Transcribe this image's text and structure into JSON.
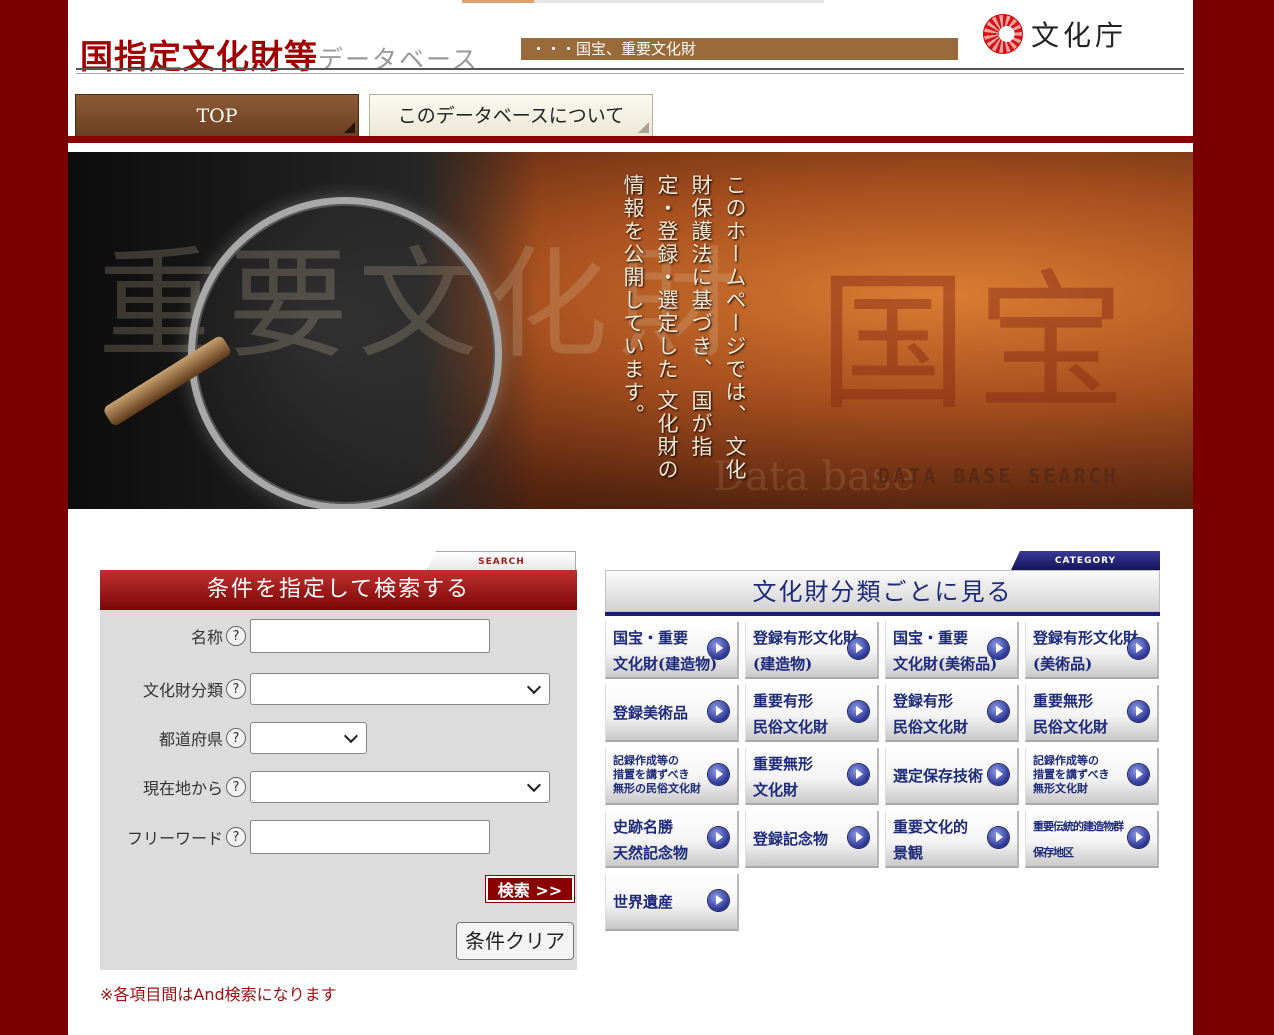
{
  "header": {
    "title_main": "国指定文化財等",
    "title_sub": "データベース",
    "band_text": "・・・国宝、重要文化財",
    "logo_text": "文化庁"
  },
  "tabs": [
    {
      "label": "TOP"
    },
    {
      "label": "このデータベースについて"
    }
  ],
  "hero": {
    "vertical_text": "このホームページでは、\n文化財保護法に基づき、\n国が指定・登録・選定した\n文化財の情報を公開しています。",
    "caption": "DATA BASE SEARCH",
    "caption_bg": "Data base",
    "bg_left": "重要文化財",
    "bg_right": "国宝"
  },
  "search": {
    "tag": "SEARCH",
    "heading": "条件を指定して検索する",
    "help_glyph": "?",
    "fields": [
      {
        "label": "名称",
        "value": ""
      },
      {
        "label": "文化財分類",
        "value": ""
      },
      {
        "label": "都道府県",
        "value": ""
      },
      {
        "label": "現在地から",
        "value": ""
      },
      {
        "label": "フリーワード",
        "value": ""
      }
    ],
    "search_button": "検索 >>",
    "clear_button": "条件クリア",
    "note": "※各項目間はAnd検索になります"
  },
  "category": {
    "tag": "CATEGORY",
    "heading": "文化財分類ごとに見る",
    "items": [
      {
        "label": "国宝・重要\n文化財(建造物)"
      },
      {
        "label": "登録有形文化財\n(建造物)"
      },
      {
        "label": "国宝・重要\n文化財(美術品)"
      },
      {
        "label": "登録有形文化財\n(美術品)"
      },
      {
        "label": "登録美術品"
      },
      {
        "label": "重要有形\n民俗文化財"
      },
      {
        "label": "登録有形\n民俗文化財"
      },
      {
        "label": "重要無形\n民俗文化財"
      },
      {
        "label": "記録作成等の\n措置を講ずべき\n無形の民俗文化財"
      },
      {
        "label": "重要無形\n文化財"
      },
      {
        "label": "選定保存技術"
      },
      {
        "label": "記録作成等の\n措置を講ずべき\n無形文化財"
      },
      {
        "label": "史跡名勝\n天然記念物"
      },
      {
        "label": "登録記念物"
      },
      {
        "label": "重要文化的\n景観"
      },
      {
        "label": "重要伝統的建造物群\n保存地区"
      },
      {
        "label": "世界遺産"
      }
    ]
  },
  "colors": {
    "frame": "#7a0000",
    "accent_red": "#8a0000",
    "navy": "#1e2a7a"
  }
}
